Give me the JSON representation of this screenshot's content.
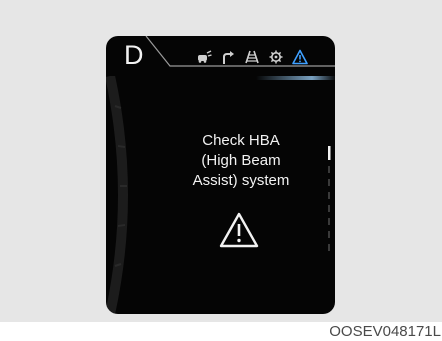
{
  "cluster": {
    "gear_indicator": "D",
    "status_icons": [
      "lane-keeping-icon",
      "turn-arrow-icon",
      "road-lanes-icon",
      "gear-settings-icon",
      "warning-triangle-icon"
    ],
    "message_lines": [
      "Check HBA",
      "(High Beam",
      "Assist) system"
    ],
    "accent_color": "#3fa0ff",
    "text_color": "#f2f2f2"
  },
  "caption": "OOSEV048171L"
}
